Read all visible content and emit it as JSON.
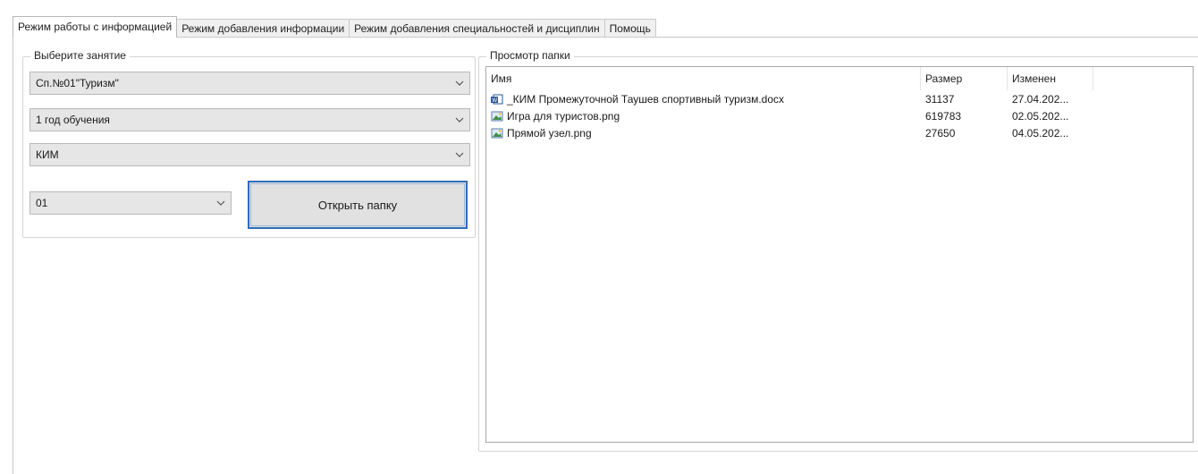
{
  "tabs": [
    {
      "label": "Режим работы с информацией",
      "active": true
    },
    {
      "label": "Режим добавления информации",
      "active": false
    },
    {
      "label": "Режим добавления специальностей и дисциплин",
      "active": false
    },
    {
      "label": "Помощь",
      "active": false
    }
  ],
  "select_group": {
    "title": "Выберите занятие",
    "speciality": "Сп.№01\"Туризм\"",
    "year": "1 год обучения",
    "type": "КИМ",
    "number": "01",
    "open_button": "Открыть папку"
  },
  "folder_group": {
    "title": "Просмотр папки",
    "columns": [
      "Имя",
      "Размер",
      "Изменен"
    ],
    "files": [
      {
        "name": "_КИМ Промежуточной Таушев спортивный туризм.docx",
        "size": "31137",
        "modified": "27.04.202...",
        "icon": "word-doc-icon"
      },
      {
        "name": "Игра для туристов.png",
        "size": "619783",
        "modified": "02.05.202...",
        "icon": "image-file-icon"
      },
      {
        "name": "Прямой узел.png",
        "size": "27650",
        "modified": "04.05.202...",
        "icon": "image-file-icon"
      }
    ]
  },
  "colors": {
    "accent_border": "#2f6db8",
    "combo_bg": "#e6e6e6"
  }
}
